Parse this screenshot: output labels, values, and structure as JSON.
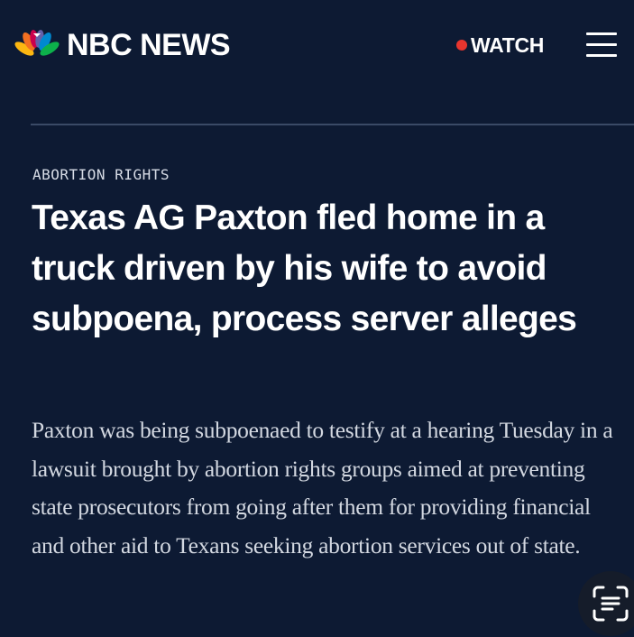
{
  "header": {
    "brand": "NBC NEWS",
    "watch_label": "WATCH"
  },
  "article": {
    "category": "ABORTION RIGHTS",
    "headline": "Texas AG Paxton fled home in a truck driven by his wife to avoid subpoena, process server alleges",
    "summary": "Paxton was being subpoenaed to testify at a hearing Tuesday in a lawsuit brought by abortion rights groups aimed at preventing state prosecutors from going after them for providing financial and other aid to Texans seeking abortion services out of state."
  },
  "icons": {
    "logo": "nbc-peacock-icon",
    "live": "live-dot-icon",
    "menu": "hamburger-menu-icon",
    "scan": "text-scan-icon"
  },
  "colors": {
    "background": "#0d1a33",
    "live_dot": "#e8352e",
    "divider": "#3a4a66",
    "peacock": [
      "#fcb711",
      "#f37021",
      "#cc004c",
      "#6460aa",
      "#0089d0",
      "#0db14b"
    ]
  }
}
